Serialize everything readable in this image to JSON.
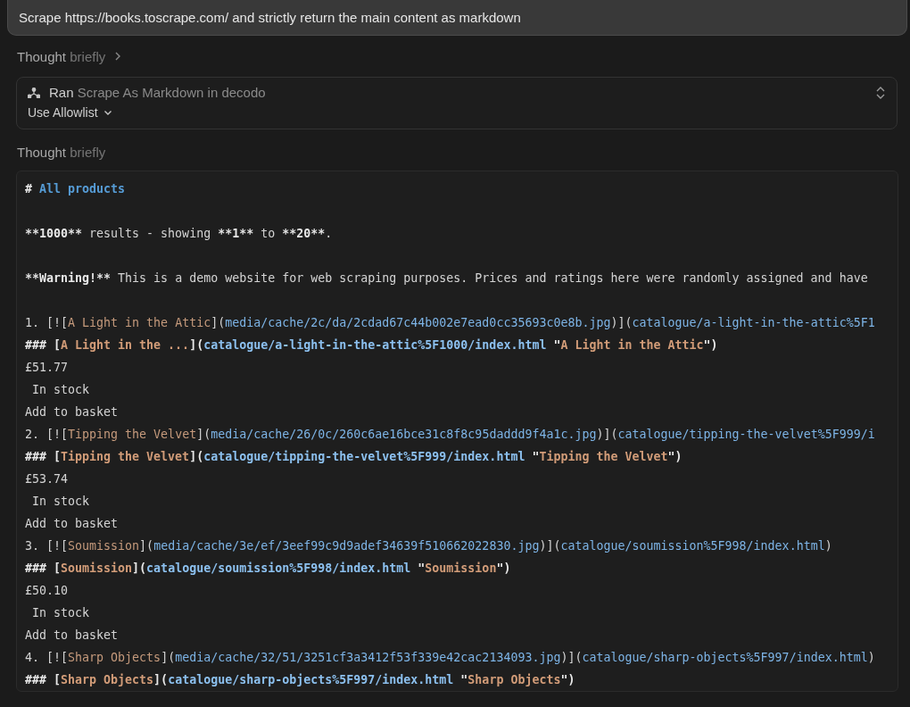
{
  "prompt": {
    "text": "Scrape https://books.toscrape.com/ and strictly return the main content as markdown"
  },
  "thought_first": {
    "label": "Thought",
    "detail": "briefly",
    "expandable": true
  },
  "tool_card": {
    "verb": "Ran",
    "action": "Scrape As Markdown in decodo",
    "dropdown": "Use Allowlist"
  },
  "thought_second": {
    "label": "Thought",
    "detail": "briefly",
    "expandable": false
  },
  "code_lines": [
    {
      "kind": "text",
      "tokens": [
        {
          "kind": "bold",
          "text": "# "
        },
        {
          "kind": "heading",
          "text": "All products"
        }
      ]
    },
    {
      "kind": "blank"
    },
    {
      "kind": "text",
      "tokens": [
        {
          "kind": "bold",
          "text": "**1000**"
        },
        {
          "kind": "plain",
          "text": " results - showing "
        },
        {
          "kind": "bold",
          "text": "**1**"
        },
        {
          "kind": "plain",
          "text": " to "
        },
        {
          "kind": "bold",
          "text": "**20**"
        },
        {
          "kind": "plain",
          "text": "."
        }
      ]
    },
    {
      "kind": "blank"
    },
    {
      "kind": "text",
      "tokens": [
        {
          "kind": "bold",
          "text": "**Warning!**"
        },
        {
          "kind": "plain",
          "text": " This is a demo website for web scraping purposes. Prices and ratings here were randomly assigned and have"
        }
      ]
    },
    {
      "kind": "blank"
    },
    {
      "kind": "text",
      "tokens": [
        {
          "kind": "plain",
          "text": "1. [!["
        },
        {
          "kind": "link",
          "text": "A Light in the Attic"
        },
        {
          "kind": "plain",
          "text": "]("
        },
        {
          "kind": "url",
          "text": "media/cache/2c/da/2cdad67c44b002e7ead0cc35693c0e8b.jpg"
        },
        {
          "kind": "plain",
          "text": ")]("
        },
        {
          "kind": "url",
          "text": "catalogue/a-light-in-the-attic%5F1"
        }
      ]
    },
    {
      "kind": "text",
      "tokens": [
        {
          "kind": "bold",
          "text": "### ["
        },
        {
          "kind": "link-bold",
          "text": "A Light in the ..."
        },
        {
          "kind": "bold",
          "text": "]("
        },
        {
          "kind": "url-bold",
          "text": "catalogue/a-light-in-the-attic%5F1000/index.html"
        },
        {
          "kind": "bold",
          "text": " \""
        },
        {
          "kind": "link-bold",
          "text": "A Light in the Attic"
        },
        {
          "kind": "bold",
          "text": "\")"
        }
      ]
    },
    {
      "kind": "text",
      "tokens": [
        {
          "kind": "plain",
          "text": "£51.77"
        }
      ]
    },
    {
      "kind": "text",
      "tokens": [
        {
          "kind": "plain",
          "text": " In stock"
        }
      ]
    },
    {
      "kind": "text",
      "tokens": [
        {
          "kind": "plain",
          "text": "Add to basket"
        }
      ]
    },
    {
      "kind": "text",
      "tokens": [
        {
          "kind": "plain",
          "text": "2. [!["
        },
        {
          "kind": "link",
          "text": "Tipping the Velvet"
        },
        {
          "kind": "plain",
          "text": "]("
        },
        {
          "kind": "url",
          "text": "media/cache/26/0c/260c6ae16bce31c8f8c95daddd9f4a1c.jpg"
        },
        {
          "kind": "plain",
          "text": ")]("
        },
        {
          "kind": "url",
          "text": "catalogue/tipping-the-velvet%5F999/i"
        }
      ]
    },
    {
      "kind": "text",
      "tokens": [
        {
          "kind": "bold",
          "text": "### ["
        },
        {
          "kind": "link-bold",
          "text": "Tipping the Velvet"
        },
        {
          "kind": "bold",
          "text": "]("
        },
        {
          "kind": "url-bold",
          "text": "catalogue/tipping-the-velvet%5F999/index.html"
        },
        {
          "kind": "bold",
          "text": " \""
        },
        {
          "kind": "link-bold",
          "text": "Tipping the Velvet"
        },
        {
          "kind": "bold",
          "text": "\")"
        }
      ]
    },
    {
      "kind": "text",
      "tokens": [
        {
          "kind": "plain",
          "text": "£53.74"
        }
      ]
    },
    {
      "kind": "text",
      "tokens": [
        {
          "kind": "plain",
          "text": " In stock"
        }
      ]
    },
    {
      "kind": "text",
      "tokens": [
        {
          "kind": "plain",
          "text": "Add to basket"
        }
      ]
    },
    {
      "kind": "text",
      "tokens": [
        {
          "kind": "plain",
          "text": "3. [!["
        },
        {
          "kind": "link",
          "text": "Soumission"
        },
        {
          "kind": "plain",
          "text": "]("
        },
        {
          "kind": "url",
          "text": "media/cache/3e/ef/3eef99c9d9adef34639f510662022830.jpg"
        },
        {
          "kind": "plain",
          "text": ")]("
        },
        {
          "kind": "url",
          "text": "catalogue/soumission%5F998/index.html"
        },
        {
          "kind": "plain",
          "text": ")"
        }
      ]
    },
    {
      "kind": "text",
      "tokens": [
        {
          "kind": "bold",
          "text": "### ["
        },
        {
          "kind": "link-bold",
          "text": "Soumission"
        },
        {
          "kind": "bold",
          "text": "]("
        },
        {
          "kind": "url-bold",
          "text": "catalogue/soumission%5F998/index.html"
        },
        {
          "kind": "bold",
          "text": " \""
        },
        {
          "kind": "link-bold",
          "text": "Soumission"
        },
        {
          "kind": "bold",
          "text": "\")"
        }
      ]
    },
    {
      "kind": "text",
      "tokens": [
        {
          "kind": "plain",
          "text": "£50.10"
        }
      ]
    },
    {
      "kind": "text",
      "tokens": [
        {
          "kind": "plain",
          "text": " In stock"
        }
      ]
    },
    {
      "kind": "text",
      "tokens": [
        {
          "kind": "plain",
          "text": "Add to basket"
        }
      ]
    },
    {
      "kind": "text",
      "tokens": [
        {
          "kind": "plain",
          "text": "4. [!["
        },
        {
          "kind": "link",
          "text": "Sharp Objects"
        },
        {
          "kind": "plain",
          "text": "]("
        },
        {
          "kind": "url",
          "text": "media/cache/32/51/3251cf3a3412f53f339e42cac2134093.jpg"
        },
        {
          "kind": "plain",
          "text": ")]("
        },
        {
          "kind": "url",
          "text": "catalogue/sharp-objects%5F997/index.html"
        },
        {
          "kind": "plain",
          "text": ")"
        }
      ]
    },
    {
      "kind": "text",
      "tokens": [
        {
          "kind": "bold",
          "text": "### ["
        },
        {
          "kind": "link-bold",
          "text": "Sharp Objects"
        },
        {
          "kind": "bold",
          "text": "]("
        },
        {
          "kind": "url-bold",
          "text": "catalogue/sharp-objects%5F997/index.html"
        },
        {
          "kind": "bold",
          "text": " \""
        },
        {
          "kind": "link-bold",
          "text": "Sharp Objects"
        },
        {
          "kind": "bold",
          "text": "\")"
        }
      ]
    }
  ]
}
